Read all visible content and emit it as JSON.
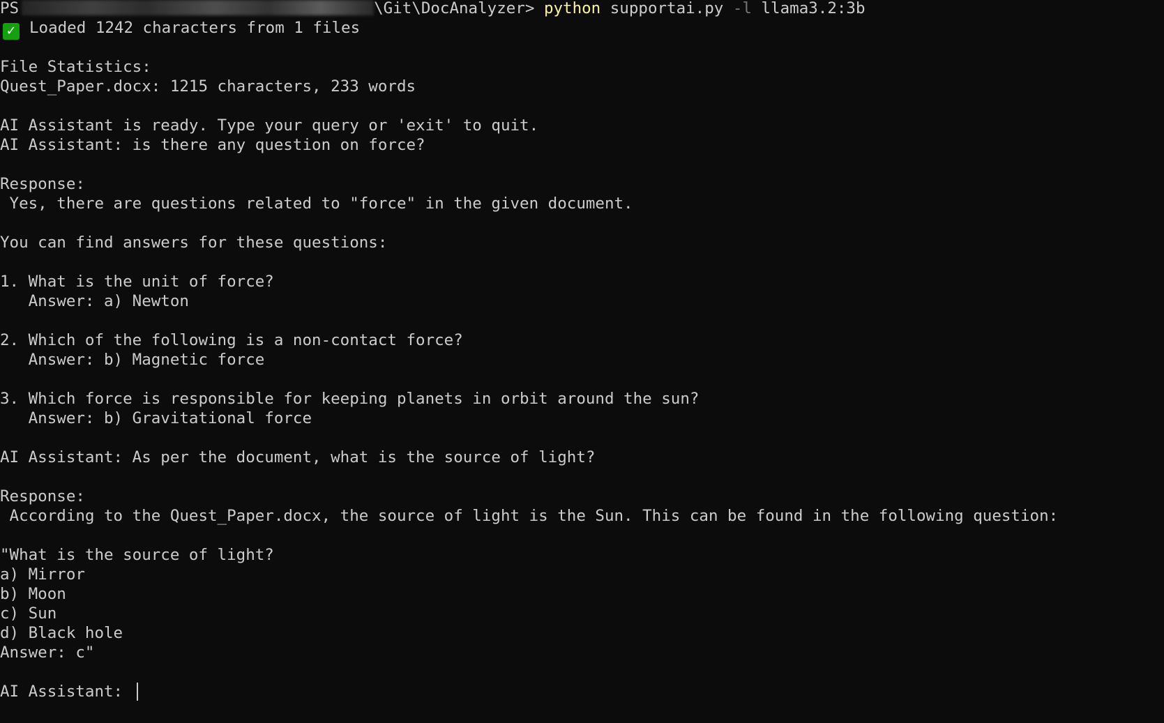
{
  "prompt": {
    "ps_prefix": "PS",
    "path_tail": "\\Git\\DocAnalyzer>",
    "command": "python",
    "script": "supportai.py",
    "flag": "-l",
    "model": "llama3.2:3b"
  },
  "status": {
    "check_icon": "white-check-mark-in-green-box",
    "loaded_text": "Loaded 1242 characters from 1 files"
  },
  "stats": {
    "heading": "File Statistics:",
    "file_line": "Quest_Paper.docx: 1215 characters, 233 words"
  },
  "ready": {
    "message": "AI Assistant is ready. Type your query or 'exit' to quit."
  },
  "exchange1": {
    "query": "AI Assistant: is there any question on force?",
    "response_label": "Response:",
    "intro": " Yes, there are questions related to \"force\" in the given document.",
    "find": "You can find answers for these questions:",
    "items": [
      {
        "question": "1. What is the unit of force?",
        "answer": "   Answer: a) Newton"
      },
      {
        "question": "2. Which of the following is a non-contact force?",
        "answer": "   Answer: b) Magnetic force"
      },
      {
        "question": "3. Which force is responsible for keeping planets in orbit around the sun?",
        "answer": "   Answer: b) Gravitational force"
      }
    ]
  },
  "exchange2": {
    "query": "AI Assistant: As per the document, what is the source of light?",
    "response_label": "Response:",
    "intro": " According to the Quest_Paper.docx, the source of light is the Sun. This can be found in the following question:",
    "quote_lines": [
      "\"What is the source of light?",
      "a) Mirror",
      "b) Moon",
      "c) Sun",
      "d) Black hole",
      "Answer: c\""
    ]
  },
  "input_prompt": "AI Assistant: ",
  "colors": {
    "background": "#0c0c0c",
    "foreground": "#cccccc",
    "command": "#f9f1a5",
    "flag": "#767676",
    "check_bg": "#13a10e"
  }
}
